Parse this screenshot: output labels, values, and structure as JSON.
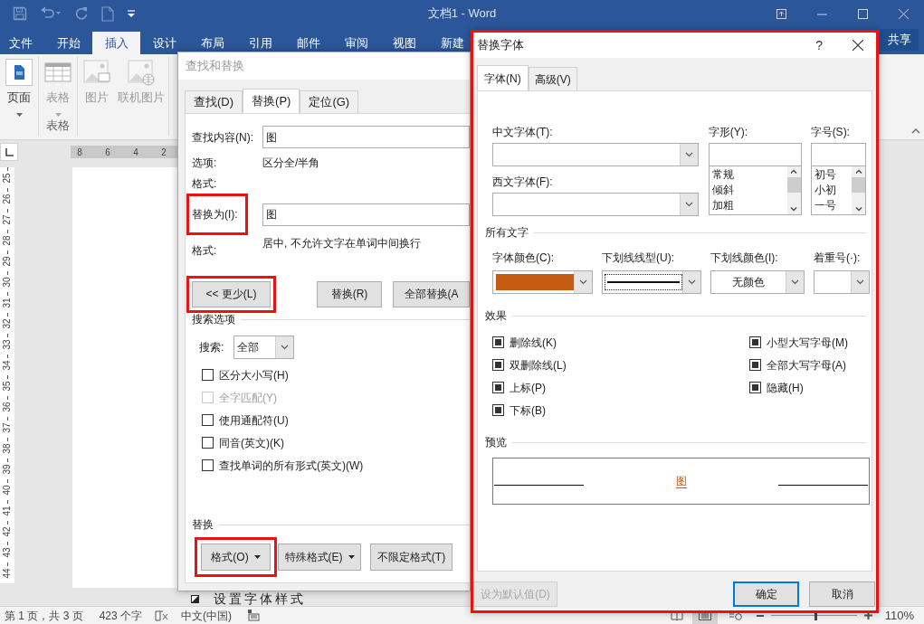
{
  "title_bar": {
    "title": "文档1 - Word"
  },
  "ribbon_tabs": [
    {
      "label": "文件",
      "selected": false
    },
    {
      "label": "开始",
      "selected": false
    },
    {
      "label": "插入",
      "selected": true
    },
    {
      "label": "设计",
      "selected": false
    },
    {
      "label": "布局",
      "selected": false
    },
    {
      "label": "引用",
      "selected": false
    },
    {
      "label": "邮件",
      "selected": false
    },
    {
      "label": "审阅",
      "selected": false
    },
    {
      "label": "视图",
      "selected": false
    },
    {
      "label": "新建",
      "selected": false
    }
  ],
  "share_button": "共享",
  "ribbon_groups": [
    {
      "buttons": [
        {
          "label": "页面",
          "kind": "pages",
          "disabled": false,
          "dropdown": true
        }
      ]
    },
    {
      "label": "表格",
      "buttons": [
        {
          "label": "表格",
          "kind": "table",
          "disabled": true,
          "dropdown": true
        }
      ]
    },
    {
      "buttons": [
        {
          "label": "图片",
          "kind": "picture",
          "disabled": true,
          "dropdown": false
        },
        {
          "label": "联机图片",
          "kind": "online-picture",
          "disabled": true,
          "dropdown": false
        }
      ]
    }
  ],
  "ruler": {
    "top_ticks": [
      "8",
      "6",
      "4",
      "2"
    ],
    "side_ticks": [
      "25",
      "26",
      "27",
      "28",
      "29",
      "30",
      "31",
      "32",
      "33",
      "34",
      "35",
      "36",
      "37",
      "38",
      "39",
      "40",
      "41",
      "42",
      "43",
      "44"
    ]
  },
  "document": {
    "list_item": "设置字体样式"
  },
  "find_replace": {
    "title": "查找和替换",
    "tabs": [
      {
        "label": "查找(D)",
        "selected": false
      },
      {
        "label": "替换(P)",
        "selected": true
      },
      {
        "label": "定位(G)",
        "selected": false
      }
    ],
    "find": {
      "label": "查找内容(N):",
      "value": "图"
    },
    "options": {
      "label": "选项:",
      "value": "区分全/半角"
    },
    "find_format": {
      "label": "格式:"
    },
    "replace": {
      "label": "替换为(I):",
      "value": "图",
      "highlighted": true
    },
    "replace_format": {
      "label": "格式:",
      "value": "居中, 不允许文字在单词中间换行"
    },
    "buttons": [
      {
        "label": "<< 更少(L)",
        "highlighted": true
      },
      {
        "label": "替换(R)",
        "highlighted": false
      },
      {
        "label": "全部替换(A",
        "highlighted": false
      }
    ],
    "search_options": {
      "title": "搜索选项",
      "search_label": "搜索:",
      "search_value": "全部",
      "checkboxes": [
        {
          "label": "区分大小写(H)",
          "checked": false,
          "disabled": false
        },
        {
          "label": "全字匹配(Y)",
          "checked": false,
          "disabled": true
        },
        {
          "label": "使用通配符(U)",
          "checked": false,
          "disabled": false
        },
        {
          "label": "同音(英文)(K)",
          "checked": false,
          "disabled": false
        },
        {
          "label": "查找单词的所有形式(英文)(W)",
          "checked": false,
          "disabled": false
        }
      ]
    },
    "replace_section": {
      "title": "替换",
      "buttons": [
        {
          "label": "格式(O)",
          "dropdown": true,
          "highlighted": true
        },
        {
          "label": "特殊格式(E)",
          "dropdown": true,
          "highlighted": false
        },
        {
          "label": "不限定格式(T)",
          "dropdown": false,
          "highlighted": false
        }
      ]
    }
  },
  "replace_font": {
    "title": "替换字体",
    "help": "?",
    "highlighted": true,
    "tabs": [
      {
        "label": "字体(N)",
        "selected": true
      },
      {
        "label": "高级(V)",
        "selected": false
      }
    ],
    "chinese_font": {
      "label": "中文字体(T):"
    },
    "western_font": {
      "label": "西文字体(F):"
    },
    "style": {
      "label": "字形(Y):",
      "options": [
        "常规",
        "倾斜",
        "加粗"
      ]
    },
    "size": {
      "label": "字号(S):",
      "options": [
        "初号",
        "小初",
        "一号"
      ]
    },
    "all_text": {
      "title": "所有文字",
      "font_color": {
        "label": "字体颜色(C):",
        "color": "#c55a11"
      },
      "underline_style": {
        "label": "下划线线型(U):"
      },
      "underline_color": {
        "label": "下划线颜色(I):",
        "value": "无颜色"
      },
      "emphasis_mark": {
        "label": "着重号(·):"
      }
    },
    "effects": {
      "title": "效果",
      "items": [
        {
          "label": "删除线(K)",
          "indeterminate": true
        },
        {
          "label": "小型大写字母(M)",
          "indeterminate": true
        },
        {
          "label": "双删除线(L)",
          "indeterminate": true
        },
        {
          "label": "全部大写字母(A)",
          "indeterminate": true
        },
        {
          "label": "上标(P)",
          "indeterminate": true
        },
        {
          "label": "隐藏(H)",
          "indeterminate": true
        },
        {
          "label": "下标(B)",
          "indeterminate": true
        }
      ]
    },
    "preview": {
      "title": "预览",
      "text": "图"
    },
    "buttons": [
      {
        "label": "设为默认值(D)",
        "disabled": true,
        "default": false
      },
      {
        "label": "确定",
        "disabled": false,
        "default": true
      },
      {
        "label": "取消",
        "disabled": false,
        "default": false
      }
    ]
  },
  "status_bar": {
    "page": "第 1 页，共 3 页",
    "words": "423 个字",
    "language": "中文(中国)",
    "zoom": "110%",
    "zoom_slider": {
      "level": 0.52
    }
  }
}
